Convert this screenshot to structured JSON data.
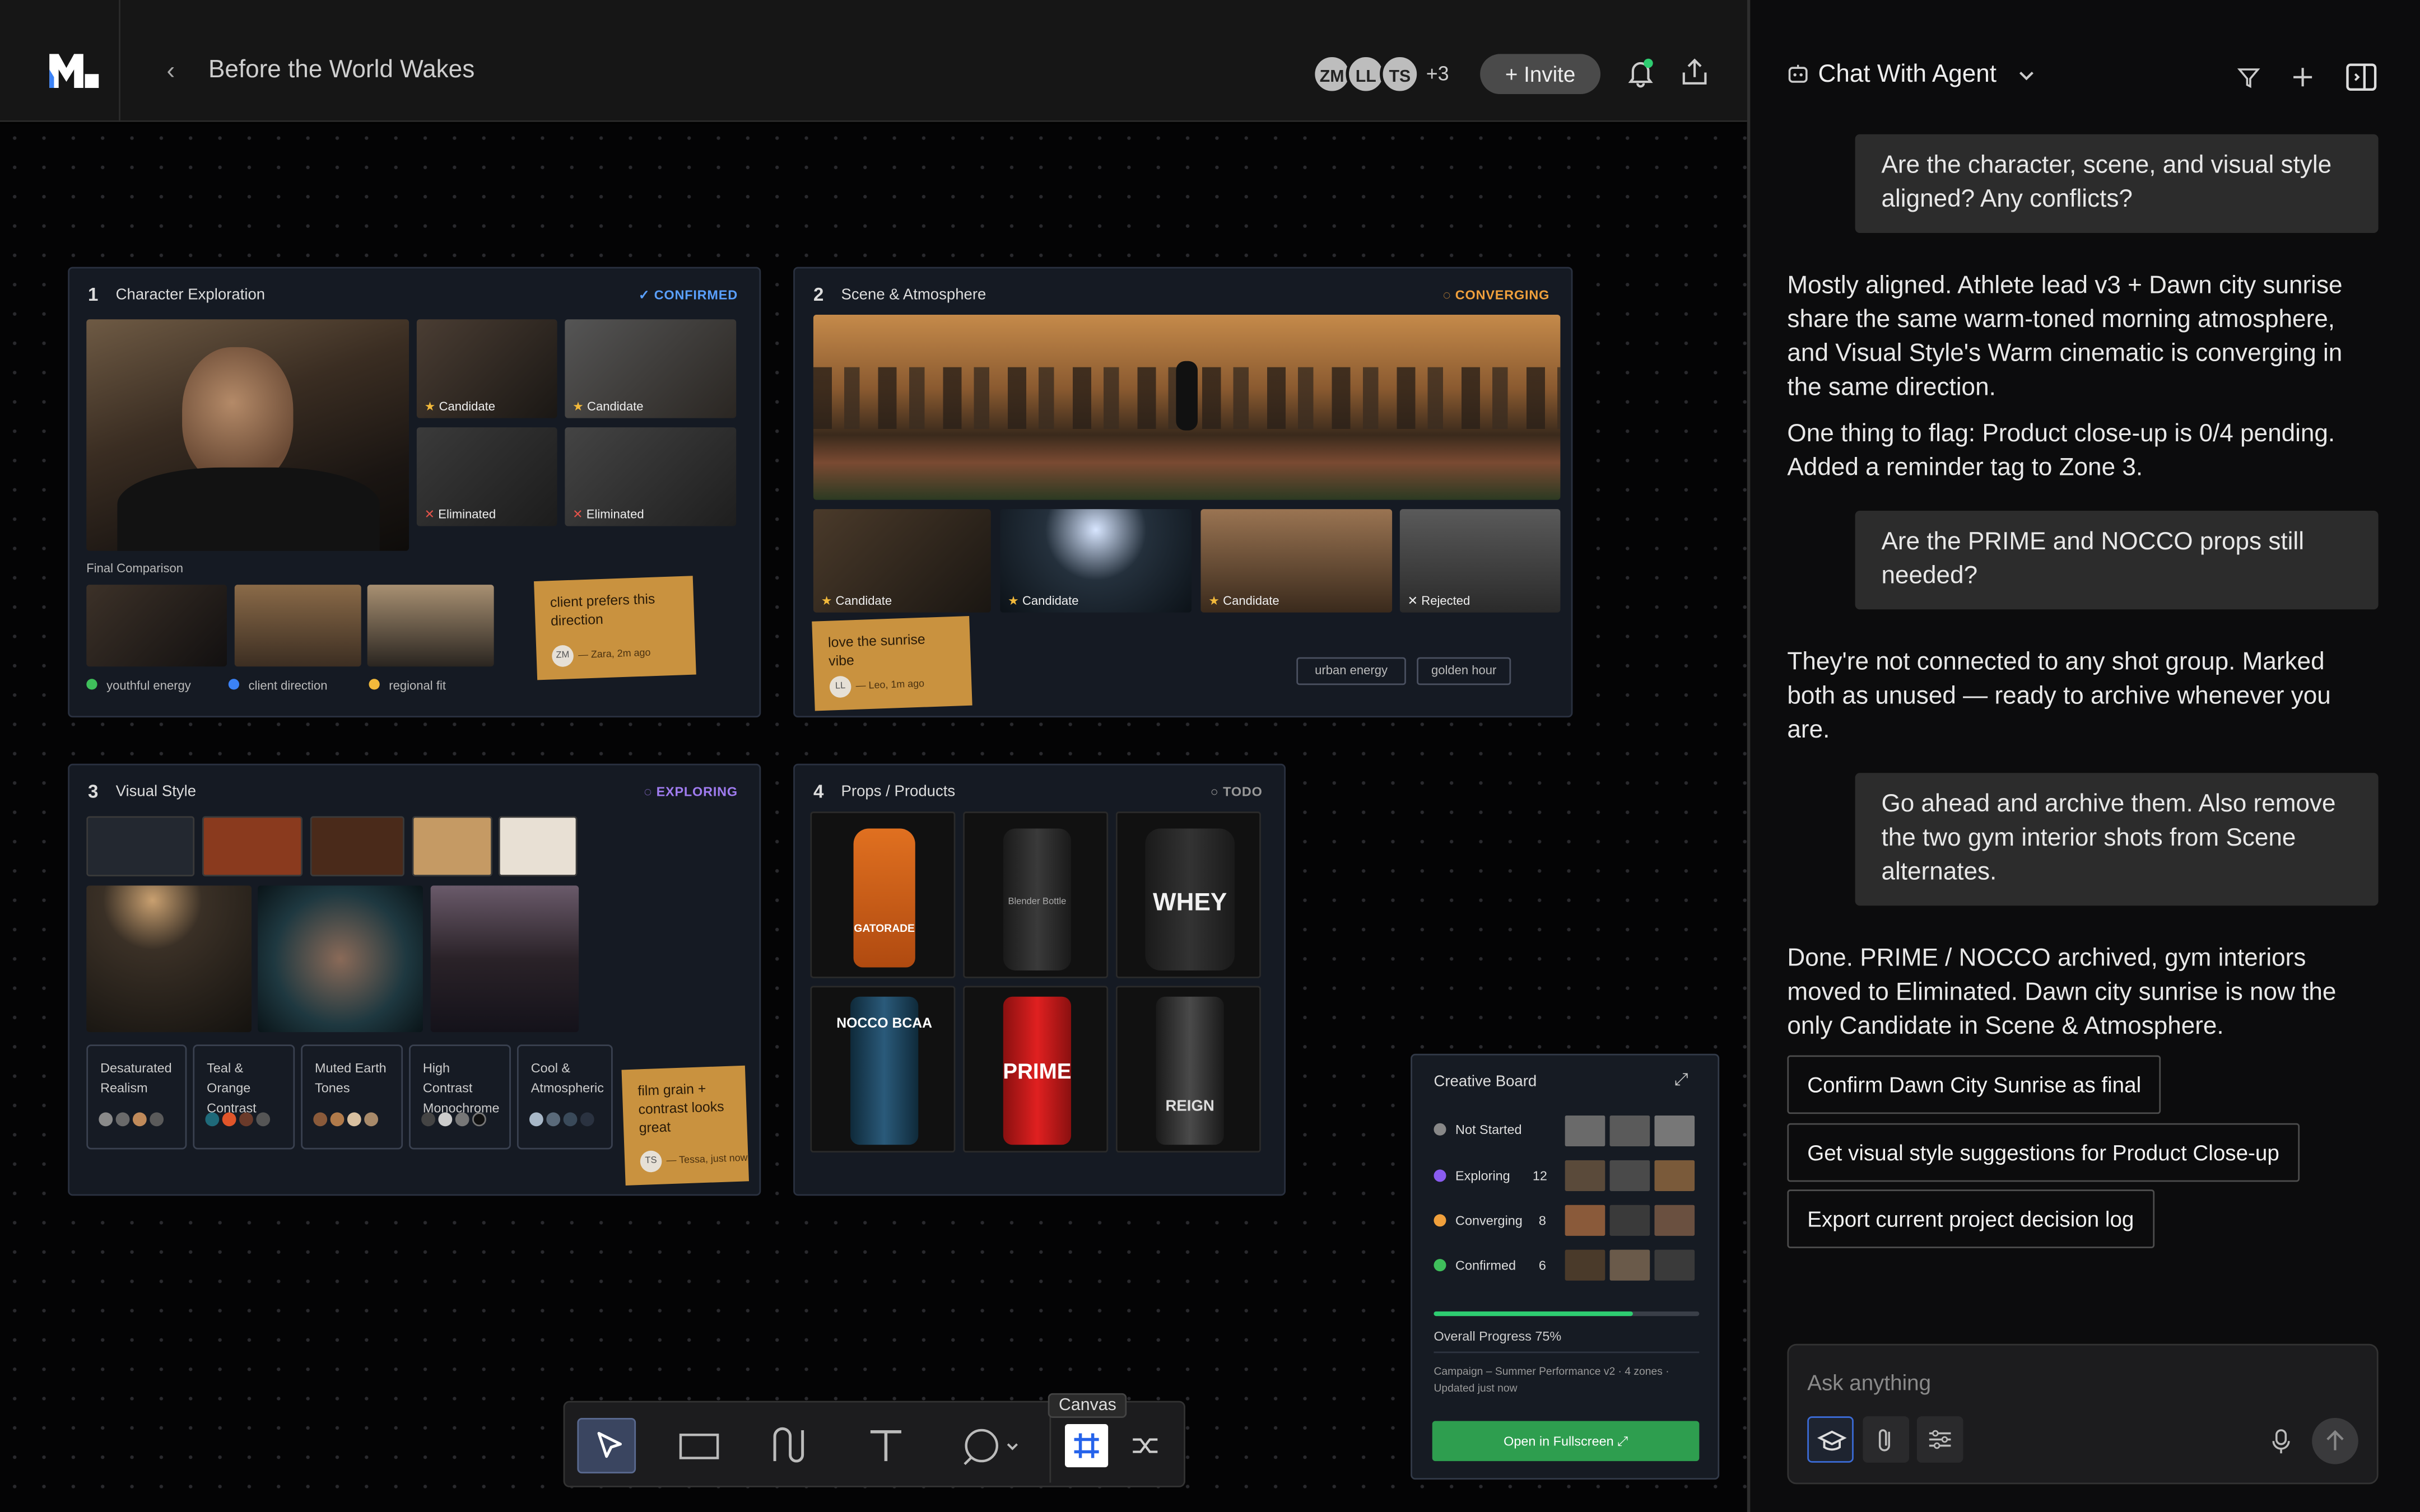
{
  "header": {
    "title": "Before the World Wakes",
    "avatars": [
      "ZM",
      "LL",
      "TS"
    ],
    "more_count": "+3",
    "invite": "+ Invite"
  },
  "zones": {
    "z1": {
      "num": "1",
      "title": "Character Exploration",
      "status": "CONFIRMED",
      "tags": [
        "Candidate",
        "Candidate",
        "Eliminated",
        "Eliminated"
      ],
      "final_label": "Final Comparison",
      "legend": [
        "youthful energy",
        "client direction",
        "regional fit"
      ],
      "note": "client prefers this direction",
      "note_by": "— Zara, 2m ago",
      "note_initials": "ZM"
    },
    "z2": {
      "num": "2",
      "title": "Scene & Atmosphere",
      "status": "CONVERGING",
      "tags": [
        "Candidate",
        "Candidate",
        "Candidate",
        "Rejected"
      ],
      "note": "love the sunrise vibe",
      "note_by": "— Leo, 1m ago",
      "note_initials": "LL",
      "chips": [
        "urban energy",
        "golden hour"
      ]
    },
    "z3": {
      "num": "3",
      "title": "Visual Style",
      "status": "EXPLORING",
      "styles": [
        "Desaturated Realism",
        "Teal & Orange Contrast",
        "Muted Earth Tones",
        "High Contrast Monochrome",
        "Cool & Atmospheric"
      ],
      "note": "film grain + contrast looks great",
      "note_by": "— Tessa, just now",
      "note_initials": "TS"
    },
    "z4": {
      "num": "4",
      "title": "Props / Products",
      "status": "TODO",
      "products": [
        "GATORADE",
        "Blender Bottle",
        "WHEY",
        "NOCCO BCAA",
        "PRIME",
        "REIGN"
      ]
    }
  },
  "creative_board": {
    "title": "Creative Board",
    "rows": [
      {
        "label": "Not Started",
        "count": ""
      },
      {
        "label": "Exploring",
        "count": "12"
      },
      {
        "label": "Converging",
        "count": "8"
      },
      {
        "label": "Confirmed",
        "count": "6"
      }
    ],
    "progress_label": "Overall Progress 75%",
    "progress": 0.75,
    "meta": "Campaign – Summer Performance v2 · 4 zones · Updated just now",
    "open": "Open in Fullscreen"
  },
  "toolbar": {
    "canvas_label": "Canvas"
  },
  "chat": {
    "title": "Chat With Agent",
    "messages": [
      {
        "role": "user",
        "text": "Are the character, scene, and visual style aligned? Any conflicts?"
      },
      {
        "role": "agent",
        "text": "Mostly aligned. Athlete lead v3 + Dawn city sunrise share the same warm-toned morning atmosphere, and Visual Style's Warm cinematic is converging in the same direction."
      },
      {
        "role": "agent",
        "text": "One thing to flag: Product close-up is 0/4 pending. Added a reminder tag to Zone 3."
      },
      {
        "role": "user",
        "text": "Are the PRIME and NOCCO props still needed?"
      },
      {
        "role": "agent",
        "text": "They're not connected to any shot group. Marked both as unused — ready to archive whenever you are."
      },
      {
        "role": "user",
        "text": "Go ahead and archive them. Also remove the two gym interior shots from Scene alternates."
      },
      {
        "role": "agent",
        "text": "Done. PRIME / NOCCO archived, gym interiors moved to Eliminated. Dawn city sunrise is now the only Candidate in Scene & Atmosphere."
      }
    ],
    "suggestions": [
      "Confirm Dawn City Sunrise as final",
      "Get visual style suggestions for Product Close-up",
      "Export current project decision log"
    ],
    "input_placeholder": "Ask anything"
  },
  "colors": {
    "confirmed": "#5aa0ff",
    "converging": "#f0a03c",
    "exploring": "#a07cf0",
    "accent_green": "#2e9e4f"
  }
}
